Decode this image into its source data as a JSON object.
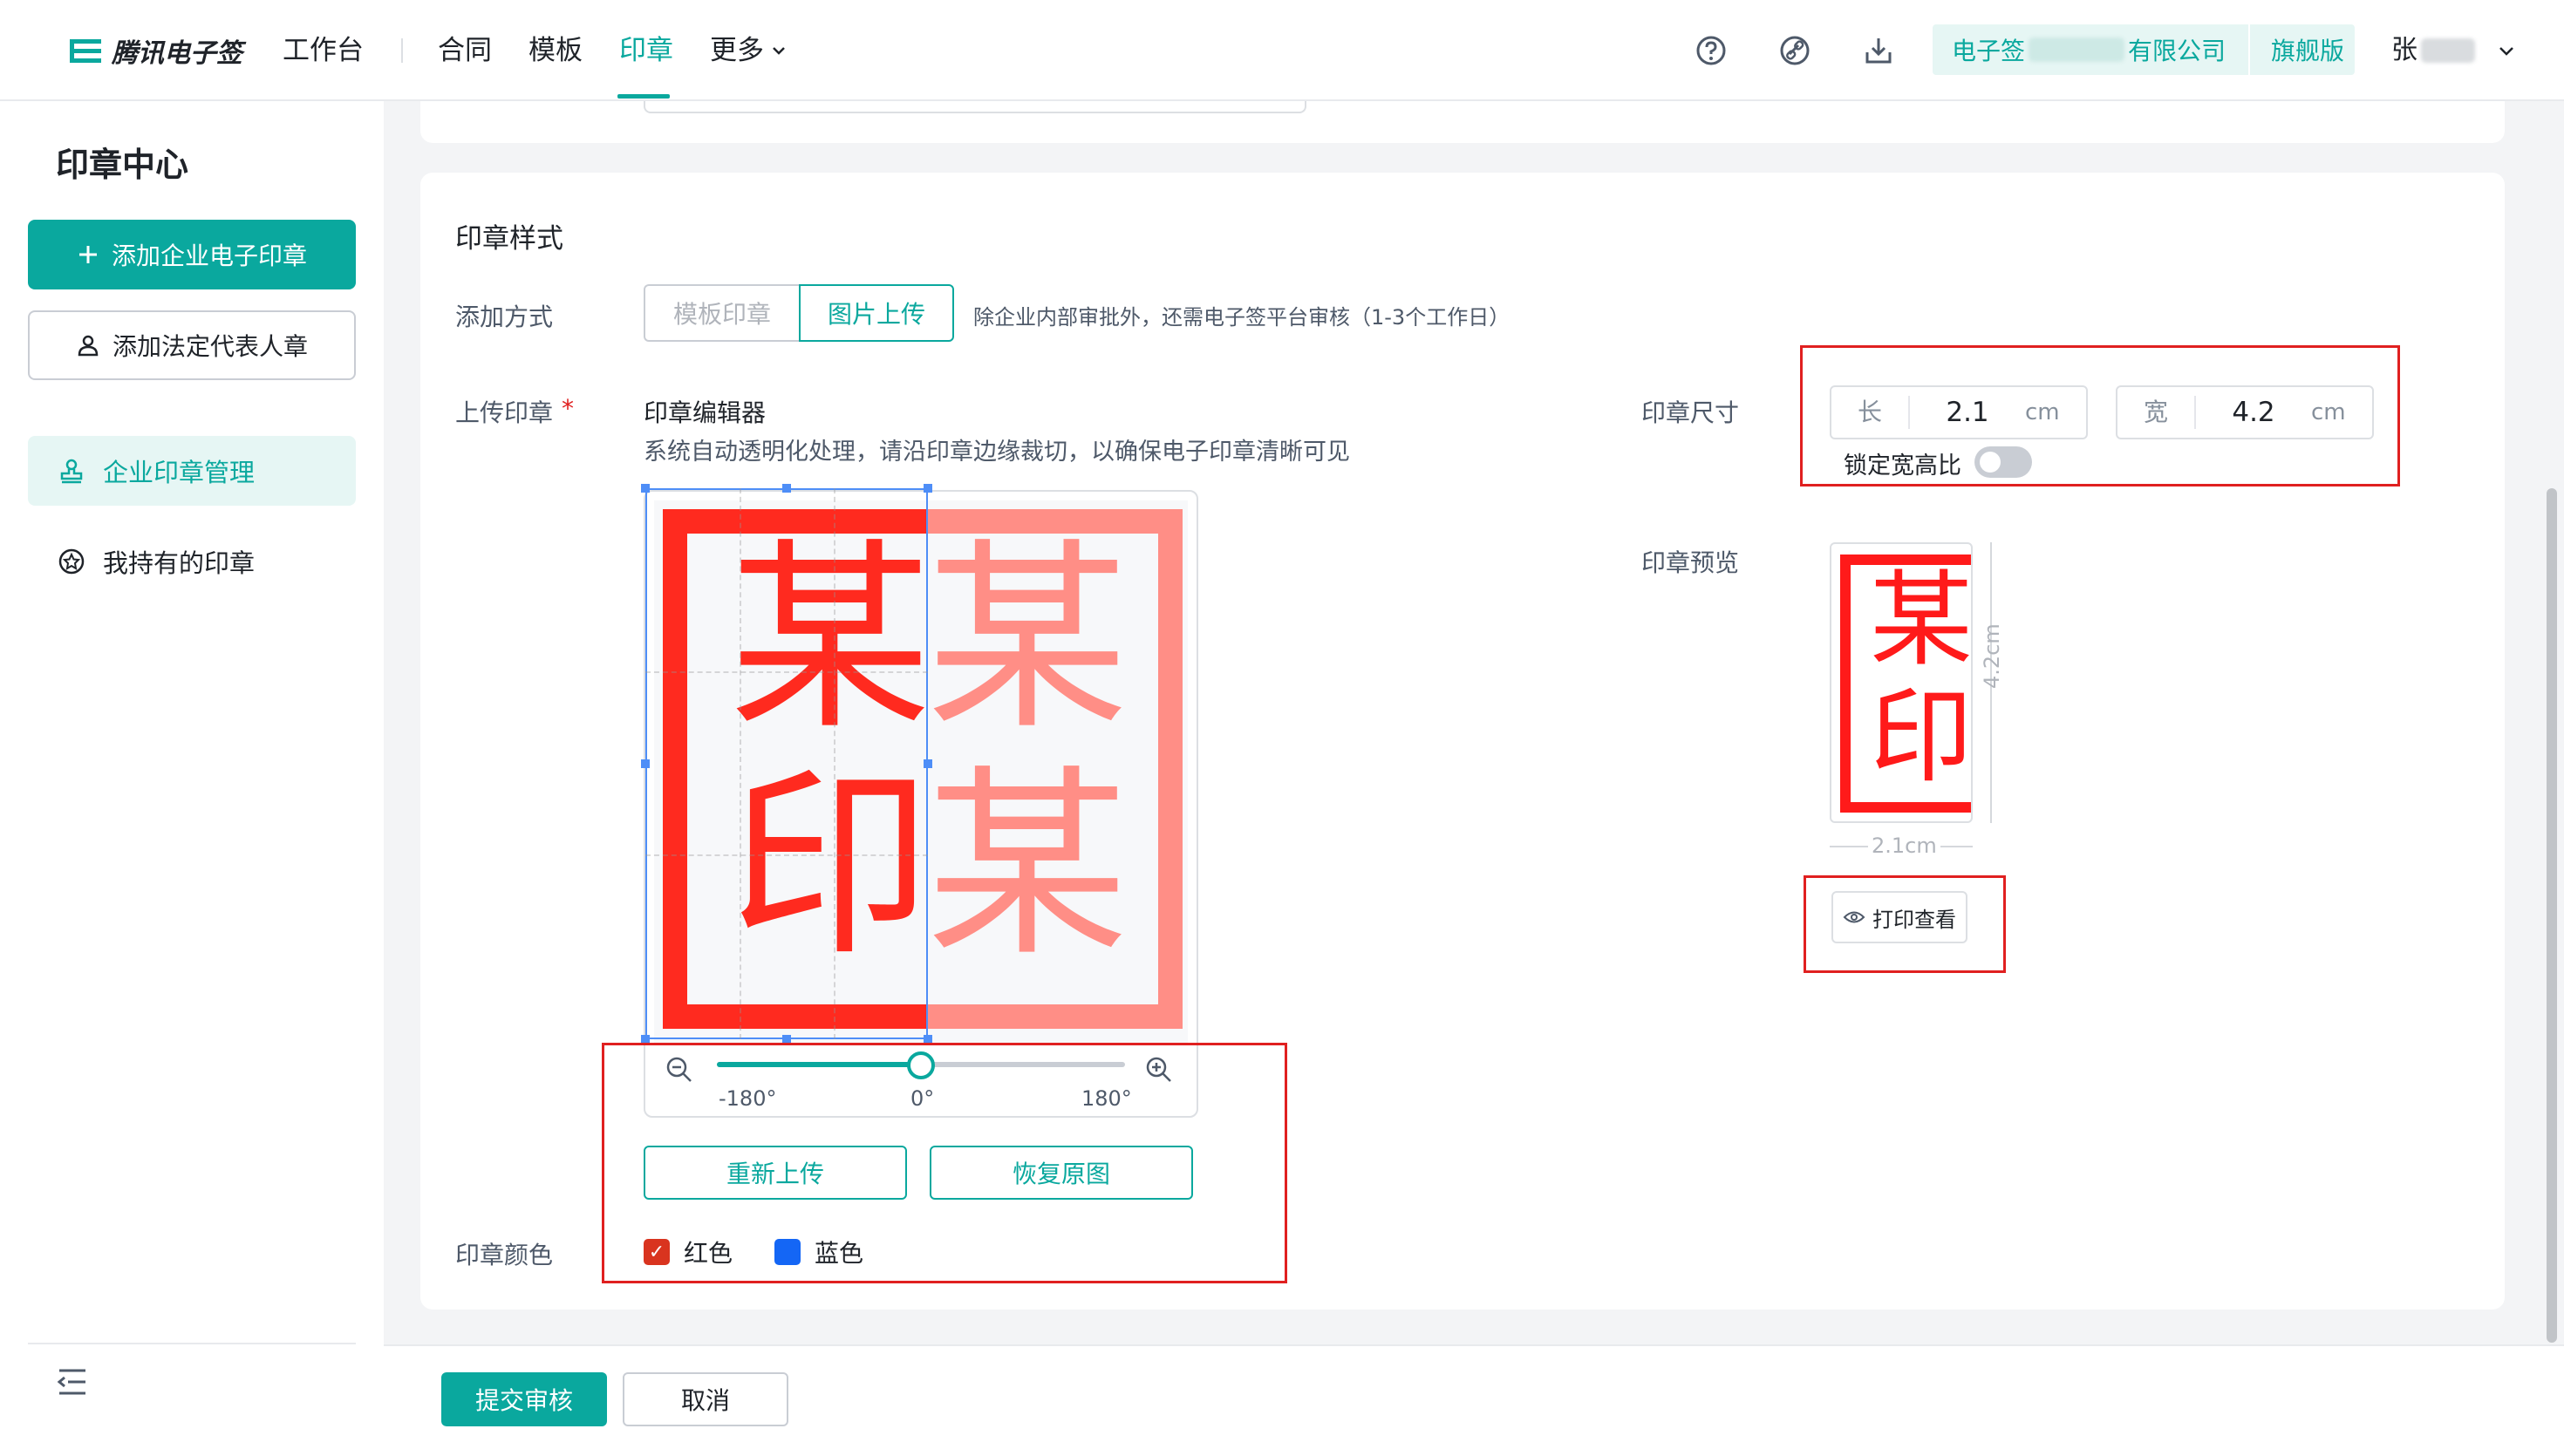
{
  "header": {
    "brand": "腾讯电子签",
    "nav": [
      {
        "label": "工作台"
      },
      {
        "label": "合同"
      },
      {
        "label": "模板"
      },
      {
        "label": "印章"
      },
      {
        "label": "更多"
      }
    ],
    "active_nav": "印章",
    "company": {
      "prefix": "电子签",
      "suffix": "有限公司",
      "tier": "旗舰版"
    },
    "user": "张"
  },
  "sidebar": {
    "title": "印章中心",
    "add_company_seal": "添加企业电子印章",
    "add_legal_seal": "添加法定代表人章",
    "items": [
      {
        "label": "企业印章管理",
        "active": true
      },
      {
        "label": "我持有的印章",
        "active": false
      }
    ]
  },
  "form": {
    "section_title": "印章样式",
    "add_method_label": "添加方式",
    "add_method_options": [
      "模板印章",
      "图片上传"
    ],
    "add_method_selected": "图片上传",
    "add_method_note": "除企业内部审批外，还需电子签平台审核（1-3个工作日）",
    "upload_label": "上传印章",
    "required_mark": "*",
    "editor_title": "印章编辑器",
    "editor_desc": "系统自动透明化处理，请沿印章边缘裁切，以确保电子印章清晰可见",
    "stamp_chars_left": [
      "某",
      "印"
    ],
    "stamp_chars_right": [
      "某",
      "某"
    ],
    "rotation": {
      "min_label": "-180°",
      "mid_label": "0°",
      "max_label": "180°",
      "value_deg": 0
    },
    "reupload_button": "重新上传",
    "restore_button": "恢复原图",
    "color_label": "印章颜色",
    "colors": [
      {
        "label": "红色",
        "checked": true,
        "hex": "#d9341f"
      },
      {
        "label": "蓝色",
        "checked": false,
        "hex": "#1466f5"
      }
    ],
    "size_label": "印章尺寸",
    "length": {
      "prefix": "长",
      "value": "2.1",
      "unit": "cm"
    },
    "width": {
      "prefix": "宽",
      "value": "4.2",
      "unit": "cm"
    },
    "lock_ratio_label": "锁定宽高比",
    "lock_ratio_on": false,
    "preview_label": "印章预览",
    "preview_chars": [
      "某",
      "印"
    ],
    "preview_height_text": "4.2cm",
    "preview_width_text": "2.1cm",
    "print_button": "打印查看"
  },
  "footer": {
    "submit": "提交审核",
    "cancel": "取消"
  },
  "colors": {
    "accent": "#0aa89e",
    "stamp_red": "#ff2a1f",
    "highlight_red": "#e02020"
  }
}
